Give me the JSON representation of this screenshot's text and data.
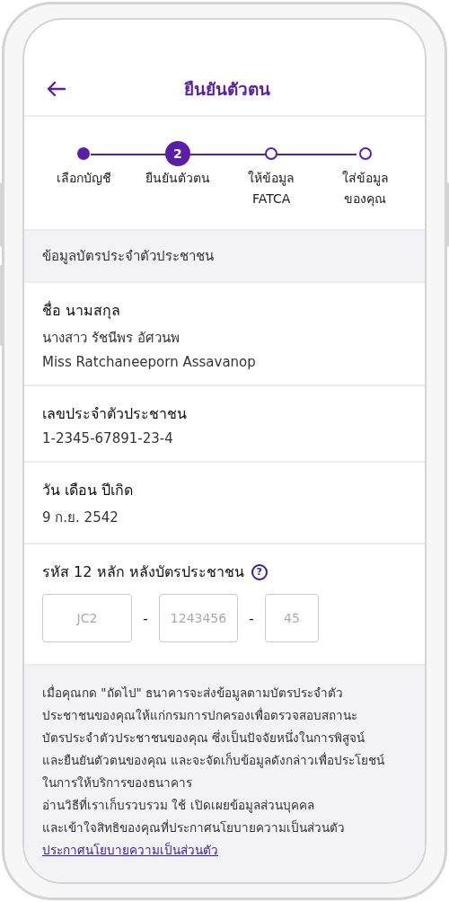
{
  "header": {
    "title": "ยืนยันตัวตน"
  },
  "steps": [
    {
      "label": "เลือกบัญชี",
      "kind": "done"
    },
    {
      "label": "ยืนยันตัวตน",
      "kind": "current",
      "number": "2"
    },
    {
      "label": "ให้ข้อมูล\nFATCA",
      "kind": "pending"
    },
    {
      "label": "ใส่ข้อมูล\nของคุณ",
      "kind": "pending"
    }
  ],
  "section_title": "ข้อมูลบัตรประจำตัวประชาชน",
  "fields": [
    {
      "label": "ชื่อ นามสกุล",
      "values": [
        "นางสาว รัชนีพร อัศวนพ",
        "Miss Ratchaneeporn Assavanop"
      ]
    },
    {
      "label": "เลขประจำตัวประชาชน",
      "values": [
        "1-2345-67891-23-4"
      ]
    },
    {
      "label": "วัน เดือน ปีเกิด",
      "values": [
        "9 ก.ย. 2542"
      ]
    }
  ],
  "laser_code": {
    "label": "รหัส 12 หลัก หลังบัตรประชาชน",
    "help": "?",
    "inputs": [
      {
        "placeholder": "JC2"
      },
      {
        "placeholder": "1243456"
      },
      {
        "placeholder": "45"
      }
    ],
    "separators": [
      "-",
      "-"
    ]
  },
  "notice": {
    "text": "เมื่อคุณกด \"ถัดไป\" ธนาคารจะส่งข้อมูลตามบัตรประจำตัว\nประชาชนของคุณให้แก่กรมการปกครองเพื่อตรวจสอบสถานะ\nบัตรประจำตัวประชาชนของคุณ ซึ่งเป็นปัจจัยหนึ่งในการพิสูจน์\nและยืนยันตัวตนของคุณ และจะจัดเก็บข้อมูลดังกล่าวเพื่อประโยชน์\nในการให้บริการของธนาคาร\nอ่านวิธีที่เราเก็บรวบรวม ใช้ เปิดเผยข้อมูลส่วนบุคคล\nและเข้าใจสิทธิของคุณที่ประกาศนโยบายความเป็นส่วนตัว",
    "link": "ประกาศนโยบายความเป็นส่วนตัว"
  }
}
